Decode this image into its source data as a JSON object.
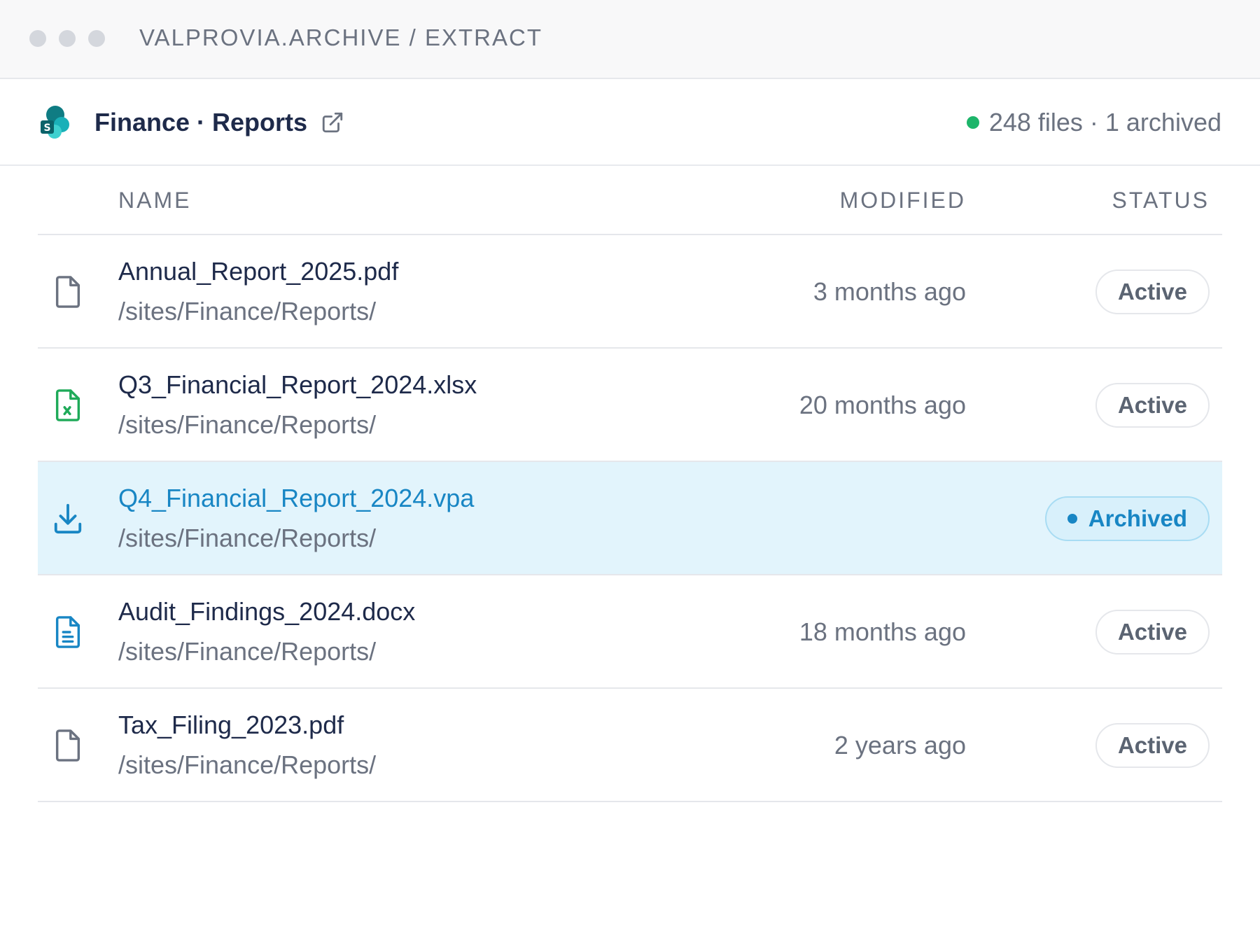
{
  "window": {
    "title": "VALPROVIA.ARCHIVE / EXTRACT"
  },
  "site": {
    "name": "Finance · Reports",
    "logo_icon": "sharepoint-logo-icon",
    "link_icon": "external-link-icon",
    "summary": "248 files · 1 archived",
    "summary_dot_color": "#1db56a"
  },
  "table": {
    "headers": {
      "name": "NAME",
      "modified": "MODIFIED",
      "status": "STATUS"
    },
    "rows": [
      {
        "icon": "file-icon",
        "name": "Annual_Report_2025.pdf",
        "path": "/sites/Finance/Reports/",
        "modified": "3 months ago",
        "status": "Active"
      },
      {
        "icon": "excel-file-icon",
        "name": "Q3_Financial_Report_2024.xlsx",
        "path": "/sites/Finance/Reports/",
        "modified": "20 months ago",
        "status": "Active"
      },
      {
        "icon": "download-icon",
        "name": "Q4_Financial_Report_2024.vpa",
        "path": "/sites/Finance/Reports/",
        "modified": "",
        "status": "Archived",
        "selected": true
      },
      {
        "icon": "document-file-icon",
        "name": "Audit_Findings_2024.docx",
        "path": "/sites/Finance/Reports/",
        "modified": "18 months ago",
        "status": "Active"
      },
      {
        "icon": "file-icon",
        "name": "Tax_Filing_2023.pdf",
        "path": "/sites/Finance/Reports/",
        "modified": "2 years ago",
        "status": "Active"
      }
    ]
  },
  "colors": {
    "accent": "#1886c4",
    "selected_row": "#e2f4fc",
    "excel_green": "#1faa59"
  }
}
